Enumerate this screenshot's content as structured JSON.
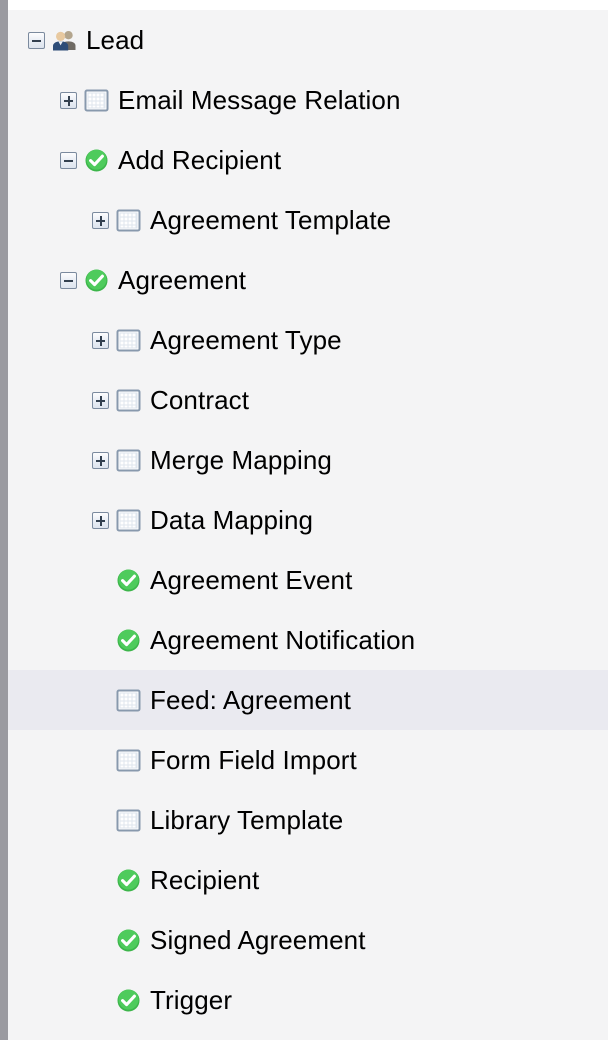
{
  "colors": {
    "panel_background": "#f4f4f5",
    "selected_row_background": "#eaeaf0",
    "gutter": "#9a9aa0",
    "text": "#000000",
    "status_green": "#3cb54a",
    "grid_icon_border": "#8899ad",
    "toggle_border": "#7b8a9e"
  },
  "tree": {
    "name": "object-relationship-tree",
    "rows": [
      {
        "label": "Lead",
        "depth": 0,
        "toggle": "minus",
        "icon": "people-icon",
        "selected": false
      },
      {
        "label": "Email Message Relation",
        "depth": 1,
        "toggle": "plus",
        "icon": "grid-table-icon",
        "selected": false
      },
      {
        "label": "Add Recipient",
        "depth": 1,
        "toggle": "minus",
        "icon": "green-check-icon",
        "selected": false
      },
      {
        "label": "Agreement Template",
        "depth": 2,
        "toggle": "plus",
        "icon": "grid-table-icon",
        "selected": false
      },
      {
        "label": "Agreement",
        "depth": 1,
        "toggle": "minus",
        "icon": "green-check-icon",
        "selected": false
      },
      {
        "label": "Agreement Type",
        "depth": 2,
        "toggle": "plus",
        "icon": "grid-table-icon",
        "selected": false
      },
      {
        "label": "Contract",
        "depth": 2,
        "toggle": "plus",
        "icon": "grid-table-icon",
        "selected": false
      },
      {
        "label": "Merge Mapping",
        "depth": 2,
        "toggle": "plus",
        "icon": "grid-table-icon",
        "selected": false
      },
      {
        "label": "Data Mapping",
        "depth": 2,
        "toggle": "plus",
        "icon": "grid-table-icon",
        "selected": false
      },
      {
        "label": "Agreement Event",
        "depth": 2,
        "toggle": "none",
        "icon": "green-check-icon",
        "selected": false
      },
      {
        "label": "Agreement Notification",
        "depth": 2,
        "toggle": "none",
        "icon": "green-check-icon",
        "selected": false
      },
      {
        "label": "Feed: Agreement",
        "depth": 2,
        "toggle": "none",
        "icon": "grid-table-icon",
        "selected": true
      },
      {
        "label": "Form Field Import",
        "depth": 2,
        "toggle": "none",
        "icon": "grid-table-icon",
        "selected": false
      },
      {
        "label": "Library Template",
        "depth": 2,
        "toggle": "none",
        "icon": "grid-table-icon",
        "selected": false
      },
      {
        "label": "Recipient",
        "depth": 2,
        "toggle": "none",
        "icon": "green-check-icon",
        "selected": false
      },
      {
        "label": "Signed Agreement",
        "depth": 2,
        "toggle": "none",
        "icon": "green-check-icon",
        "selected": false
      },
      {
        "label": "Trigger",
        "depth": 2,
        "toggle": "none",
        "icon": "green-check-icon",
        "selected": false
      }
    ]
  }
}
